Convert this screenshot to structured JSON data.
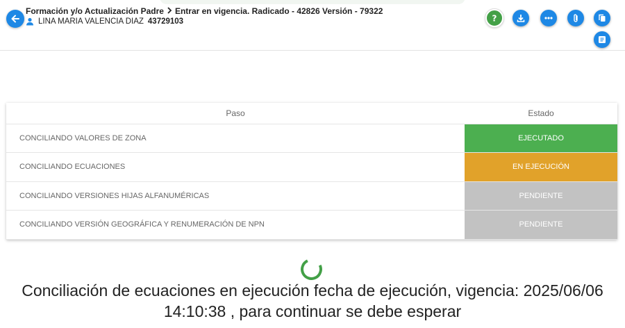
{
  "header": {
    "breadcrumb_parent": "Formación y/o Actualización Padre",
    "breadcrumb_current": "Entrar en vigencia. Radicado - 42826 Versión - 79322",
    "user_name": "LINA MARIA VALENCIA DIAZ",
    "user_id": "43729103"
  },
  "toolbar": {
    "icons": [
      "help-icon",
      "download-icon",
      "more-icon",
      "attach-icon",
      "copy-icon",
      "notes-icon"
    ]
  },
  "table": {
    "headers": [
      "Paso",
      "Estado"
    ],
    "rows": [
      {
        "step": "CONCILIANDO VALORES DE ZONA",
        "status": "EJECUTADO"
      },
      {
        "step": "CONCILIANDO ECUACIONES",
        "status": "EN EJECUCIÓN"
      },
      {
        "step": "CONCILIANDO VERSIONES HIJAS ALFANUMÉRICAS",
        "status": "PENDIENTE"
      },
      {
        "step": "CONCILIANDO VERSIÓN GEOGRÁFICA Y RENUMERACIÓN DE NPN",
        "status": "PENDIENTE"
      }
    ]
  },
  "status_colors": {
    "executed": "#4caf50",
    "running": "#e1a22a",
    "pending": "#c2c2c2",
    "accent": "#1e88e5"
  },
  "message": {
    "line1": "Conciliación de ecuaciones en ejecución fecha de ejecución, vigencia: 2025/06/06",
    "line2": "14:10:38 , para continuar se debe esperar"
  }
}
